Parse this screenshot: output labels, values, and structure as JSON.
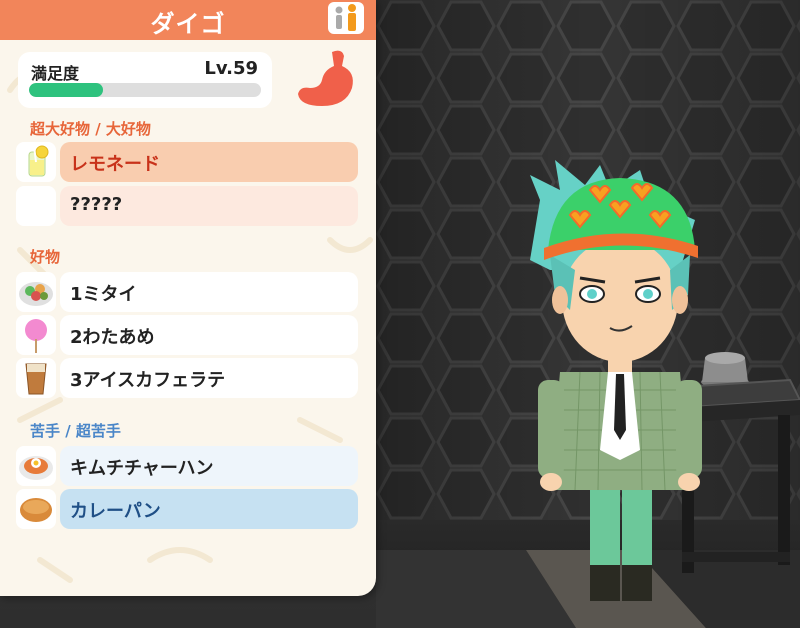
{
  "character": {
    "name": "ダイゴ"
  },
  "satisfaction": {
    "label": "満足度",
    "level": "Lv.59",
    "progress": 0.32
  },
  "sections": {
    "super_favorite": {
      "label": "超大好物 / 大好物"
    },
    "favorite": {
      "label": "好物"
    },
    "disliked": {
      "label": "苦手 / 超苦手"
    }
  },
  "super_favorites": [
    {
      "label": "レモネード",
      "icon": "lemonade-icon"
    },
    {
      "label": "?????",
      "icon": ""
    }
  ],
  "favorites": [
    {
      "label": "1ミタイ",
      "icon": "salad-icon"
    },
    {
      "label": "2わたあめ",
      "icon": "cotton-candy-icon"
    },
    {
      "label": "3アイスカフェラテ",
      "icon": "iced-latte-icon"
    }
  ],
  "dislikes": [
    {
      "label": "キムチチャーハン",
      "icon": "kimchi-fried-rice-icon"
    },
    {
      "label": "カレーパン",
      "icon": "curry-bread-icon"
    }
  ],
  "colors": {
    "header": "#f2855a",
    "super_favorite_row": "#f9cdaf",
    "favorite_row": "#ffffff",
    "dislike_row": "#eef5fb",
    "worst_row": "#c6e1f2",
    "progress": "#2ec27e"
  }
}
